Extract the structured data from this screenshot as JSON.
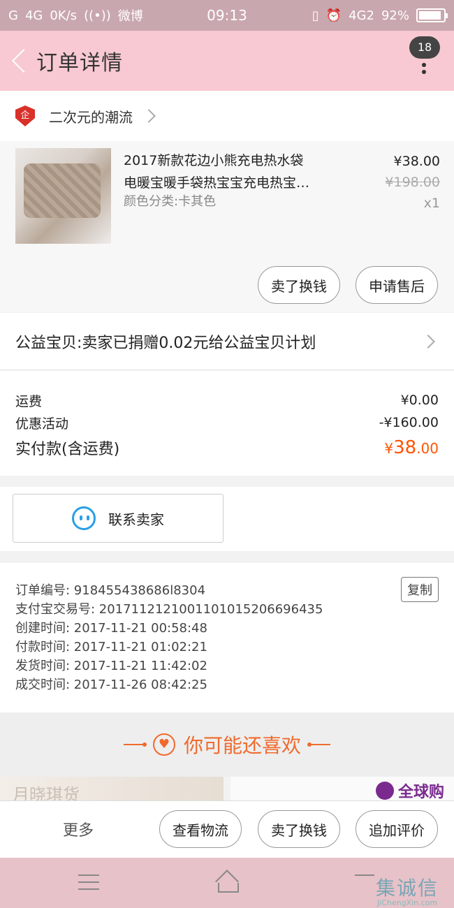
{
  "status_bar": {
    "left": [
      "G",
      "4G",
      "0K/s",
      "((•))",
      "微博"
    ],
    "time": "09:13",
    "right": [
      "4G2",
      "92%"
    ],
    "battery_level": 0.92
  },
  "nav": {
    "title": "订单详情",
    "badge": "18"
  },
  "shop": {
    "name": "二次元的潮流",
    "icon_text": "企"
  },
  "product": {
    "title_line1": "2017新款花边小熊充电热水袋",
    "title_line2": "电暖宝暖手袋热宝宝充电热宝…",
    "spec": "颜色分类:卡其色",
    "price": "¥38.00",
    "original_price": "¥198.00",
    "qty": "x1",
    "btn_sell": "卖了换钱",
    "btn_after_sale": "申请售后"
  },
  "charity": {
    "text": "公益宝贝:卖家已捐赠0.02元给公益宝贝计划"
  },
  "fees": {
    "shipping_label": "运费",
    "shipping_value": "¥0.00",
    "discount_label": "优惠活动",
    "discount_value": "-¥160.00",
    "total_label": "实付款(含运费)",
    "total_currency": "¥",
    "total_main": "38",
    "total_decimal": ".00"
  },
  "contact": {
    "label": "联系卖家"
  },
  "order_info": {
    "copy_label": "复制",
    "lines": [
      "订单编号: 918455438686l8304",
      "支付宝交易号: 2017112121001101015206696435",
      "创建时间: 2017-11-21 00:58:48",
      "付款时间: 2017-11-21 01:02:21",
      "发货时间: 2017-11-21 11:42:02",
      "成交时间: 2017-11-26 08:42:25"
    ]
  },
  "recommend": {
    "title": "你可能还喜欢",
    "heart": "♥",
    "card_left_text": "月晓琪货",
    "card_right_tag": "全球购"
  },
  "bottom_bar": {
    "more": "更多",
    "btn_logistics": "查看物流",
    "btn_sell": "卖了换钱",
    "btn_review": "追加评价"
  },
  "watermark": {
    "cn": "集诚信",
    "en": "JiChengXin.com"
  },
  "colors": {
    "nav_bg": "#f8c9d2",
    "status_bg": "#c9a7ae",
    "accent_orange": "#ff5500",
    "chat_blue": "#27a0e6",
    "shop_red": "#d9302a"
  }
}
